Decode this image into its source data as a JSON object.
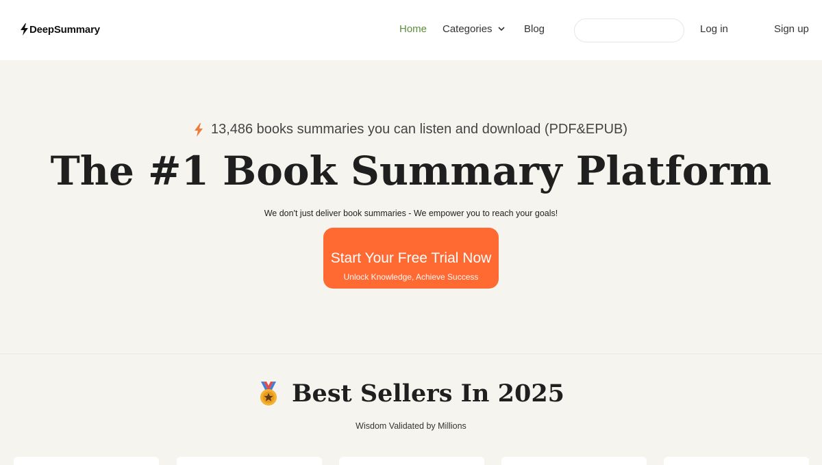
{
  "brand": {
    "name": "DeepSummary"
  },
  "nav": {
    "home": "Home",
    "categories": "Categories",
    "blog": "Blog",
    "search_placeholder": "",
    "login": "Log in",
    "signup": "Sign up"
  },
  "hero": {
    "tagline": "13,486 books summaries you can listen and download (PDF&EPUB)",
    "title": "The #1 Book Summary Platform",
    "subtitle": "We don't just deliver book summaries - We empower you to reach your goals!",
    "cta_main": "Start Your Free Trial Now",
    "cta_sub": "Unlock Knowledge, Achieve Success"
  },
  "bestsellers": {
    "title": "Best Sellers In 2025",
    "subtitle": "Wisdom Validated by Millions",
    "icon": "medal-icon"
  },
  "colors": {
    "accent": "#ff6a33",
    "nav_active": "#5a8f3c",
    "background": "#f6f4ee"
  }
}
